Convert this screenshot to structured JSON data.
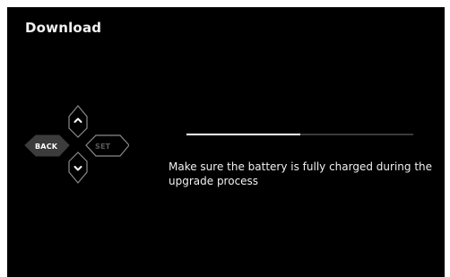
{
  "header": {
    "title": "Download"
  },
  "dpad": {
    "back_label": "BACK",
    "set_label": "SET",
    "up_icon": "chevron-up-icon",
    "down_icon": "chevron-down-icon"
  },
  "progress": {
    "fraction": 0.5
  },
  "message": "Make sure the battery is fully charged during the upgrade process",
  "colors": {
    "background": "#000000",
    "text": "#ffffff",
    "progress_fill": "#ffffff",
    "progress_track": "#3a3a3a",
    "back_button_fill": "#3c3c3c",
    "outline": "#8a8a8a",
    "set_text": "#5a5a5a"
  }
}
